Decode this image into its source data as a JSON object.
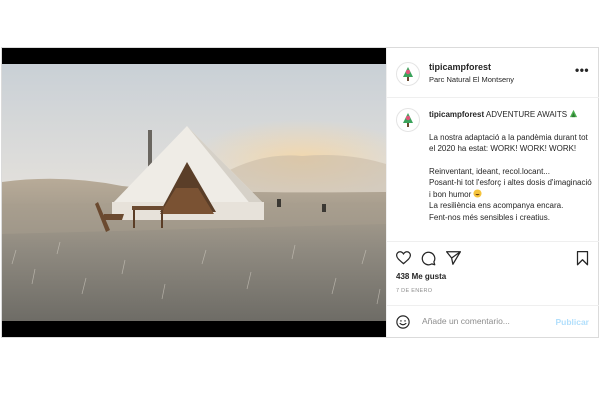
{
  "post": {
    "username": "tipicampforest",
    "location": "Parc Natural El Montseny",
    "caption_headline": "ADVENTURE AWAITS",
    "caption_lines": [
      "La nostra adaptació a la pandèmia durant tot el 2020 ha estat: WORK! WORK! WORK!",
      "Reinventant, ideant, recol.locant...",
      "Posant-hi tot l'esforç i altes dosis d'imaginació i bon humor",
      "La resiliència ens acompanya encara.",
      "Fent-nos més sensibles i creatius."
    ],
    "likes": "438 Me gusta",
    "date": "7 DE ENERO",
    "comment_placeholder": "Añade un comentario...",
    "publish_label": "Publicar"
  },
  "icons": {
    "more": "more-options-icon",
    "like": "heart-icon",
    "comment": "comment-icon",
    "share": "paper-plane-icon",
    "save": "bookmark-icon",
    "emoji": "smiley-icon"
  },
  "colors": {
    "text": "#262626",
    "muted": "#8e8e8e",
    "border": "#dbdbdb",
    "publish_disabled": "#b2dffc"
  }
}
